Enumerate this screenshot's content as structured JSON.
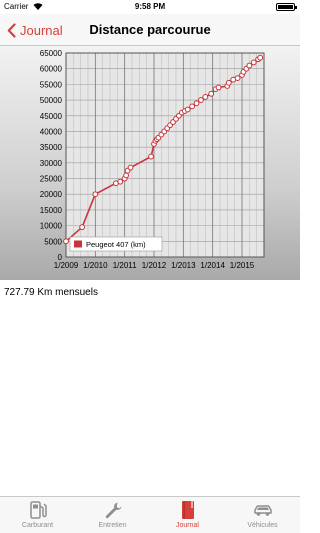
{
  "status_bar": {
    "carrier": "Carrier",
    "time": "9:58 PM"
  },
  "nav": {
    "back_label": "Journal",
    "title": "Distance parcourue"
  },
  "summary": "727.79 Km mensuels",
  "tabs": [
    {
      "label": "Carburant",
      "icon": "fuel-pump-icon",
      "active": false
    },
    {
      "label": "Entretien",
      "icon": "wrench-icon",
      "active": false
    },
    {
      "label": "Journal",
      "icon": "book-icon",
      "active": true
    },
    {
      "label": "Véhicules",
      "icon": "car-icon",
      "active": false
    }
  ],
  "colors": {
    "accent": "#d7403a",
    "line": "#c8343a",
    "tab_inactive": "#8e8e93"
  },
  "chart_data": {
    "type": "line",
    "title": "",
    "xlabel": "",
    "ylabel": "",
    "xlim": [
      2009.0,
      2015.75
    ],
    "ylim": [
      0,
      65000
    ],
    "x_ticks": [
      "1/2009",
      "1/2010",
      "1/2011",
      "1/2012",
      "1/2013",
      "1/2014",
      "1/2015"
    ],
    "y_ticks": [
      0,
      5000,
      10000,
      15000,
      20000,
      25000,
      30000,
      35000,
      40000,
      45000,
      50000,
      55000,
      60000,
      65000
    ],
    "grid": true,
    "legend_position": "bottom-left",
    "series": [
      {
        "name": "Peugeot 407 (km)",
        "x": [
          2009.0,
          2009.55,
          2010.0,
          2010.7,
          2010.85,
          2011.0,
          2011.05,
          2011.1,
          2011.2,
          2011.9,
          2012.0,
          2012.05,
          2012.1,
          2012.15,
          2012.25,
          2012.35,
          2012.45,
          2012.55,
          2012.65,
          2012.75,
          2012.85,
          2012.95,
          2013.05,
          2013.15,
          2013.3,
          2013.45,
          2013.6,
          2013.75,
          2013.95,
          2014.1,
          2014.2,
          2014.5,
          2014.55,
          2014.7,
          2014.85,
          2015.0,
          2015.05,
          2015.15,
          2015.25,
          2015.4,
          2015.55,
          2015.62
        ],
        "y": [
          5000,
          9500,
          20000,
          23500,
          24000,
          25000,
          26000,
          27500,
          28500,
          32000,
          36000,
          37000,
          37500,
          38000,
          39000,
          40000,
          41000,
          42000,
          43000,
          44000,
          45000,
          46000,
          46500,
          47000,
          48000,
          49000,
          50000,
          51000,
          52000,
          53500,
          54000,
          54500,
          55500,
          56500,
          57000,
          58000,
          59000,
          60000,
          61000,
          62000,
          63000,
          63500
        ]
      }
    ]
  }
}
